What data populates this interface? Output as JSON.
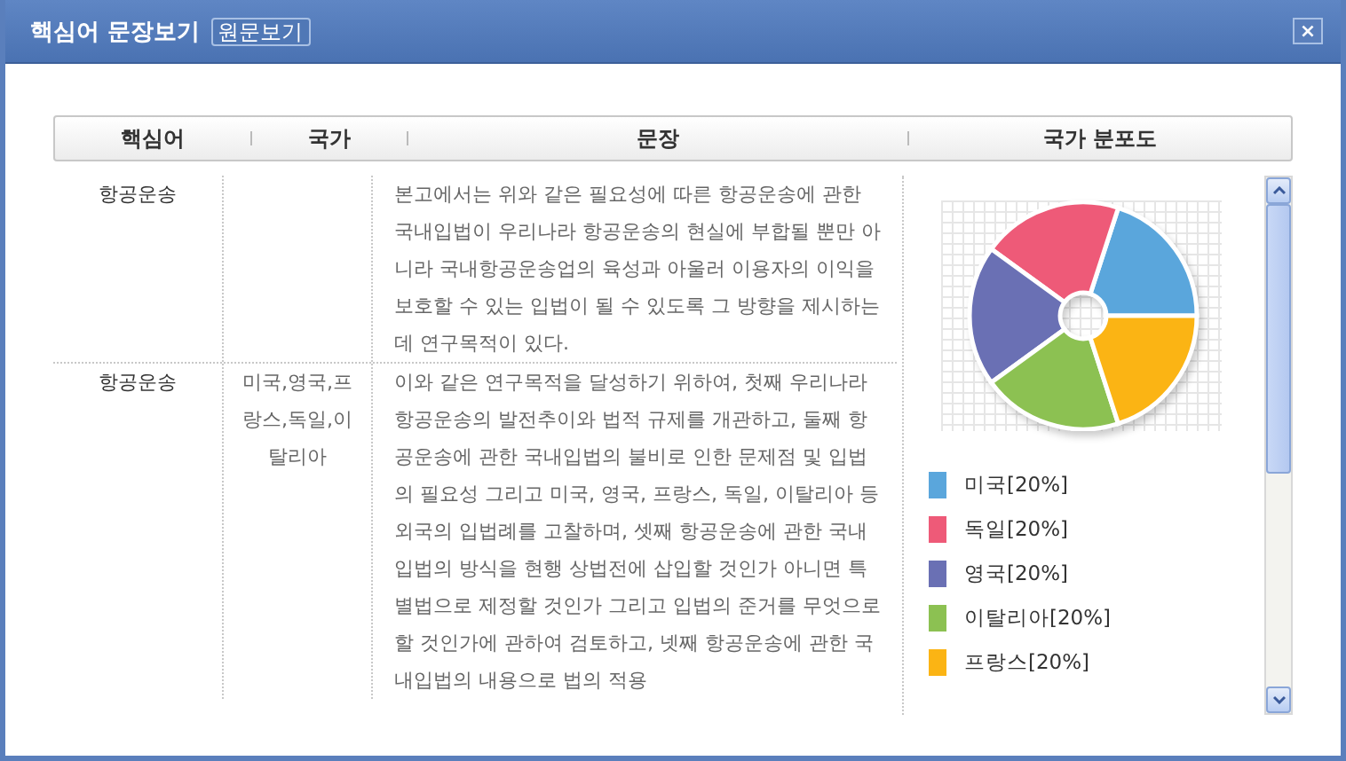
{
  "window": {
    "title": "핵심어 문장보기",
    "original_button": "원문보기",
    "close": "×"
  },
  "table": {
    "columns": [
      "핵심어",
      "국가",
      "문장",
      "국가 분포도"
    ],
    "rows": [
      {
        "keyword": "항공운송",
        "countries": "",
        "sentence": "본고에서는 위와 같은 필요성에 따른 항공운송에 관한 국내입법이 우리나라 항공운송의 현실에 부합될 뿐만 아니라 국내항공운송업의 육성과 아울러 이용자의 이익을 보호할 수 있는 입법이 될 수 있도록 그 방향을 제시하는데 연구목적이 있다."
      },
      {
        "keyword": "항공운송",
        "countries": "미국,영국,프랑스,독일,이탈리아",
        "sentence": "이와 같은 연구목적을 달성하기 위하여, 첫째 우리나라 항공운송의 발전추이와 법적 규제를 개관하고, 둘째 항공운송에 관한 국내입법의 불비로 인한 문제점 및 입법의 필요성 그리고 미국, 영국, 프랑스, 독일, 이탈리아 등 외국의 입법례를 고찰하며, 셋째 항공운송에 관한 국내입법의 방식을 현행 상법전에 삽입할 것인가 아니면 특별법으로 제정할 것인가 그리고 입법의 준거를 무엇으로 할 것인가에 관하여 검토하고, 넷째 항공운송에 관한 국내입법의 내용으로 법의 적용"
      }
    ]
  },
  "distribution": {
    "chart_data": {
      "type": "donut",
      "categories": [
        "미국[20%]",
        "독일[20%]",
        "영국[20%]",
        "이탈리아[20%]",
        "프랑스[20%]"
      ],
      "values": [
        20,
        20,
        20,
        20,
        20
      ]
    },
    "legend": [
      {
        "color": "#5aa6dc"
      },
      {
        "color": "#ee5a78"
      },
      {
        "color": "#6a70b4"
      },
      {
        "color": "#8cc152"
      },
      {
        "color": "#fbb414"
      }
    ]
  }
}
